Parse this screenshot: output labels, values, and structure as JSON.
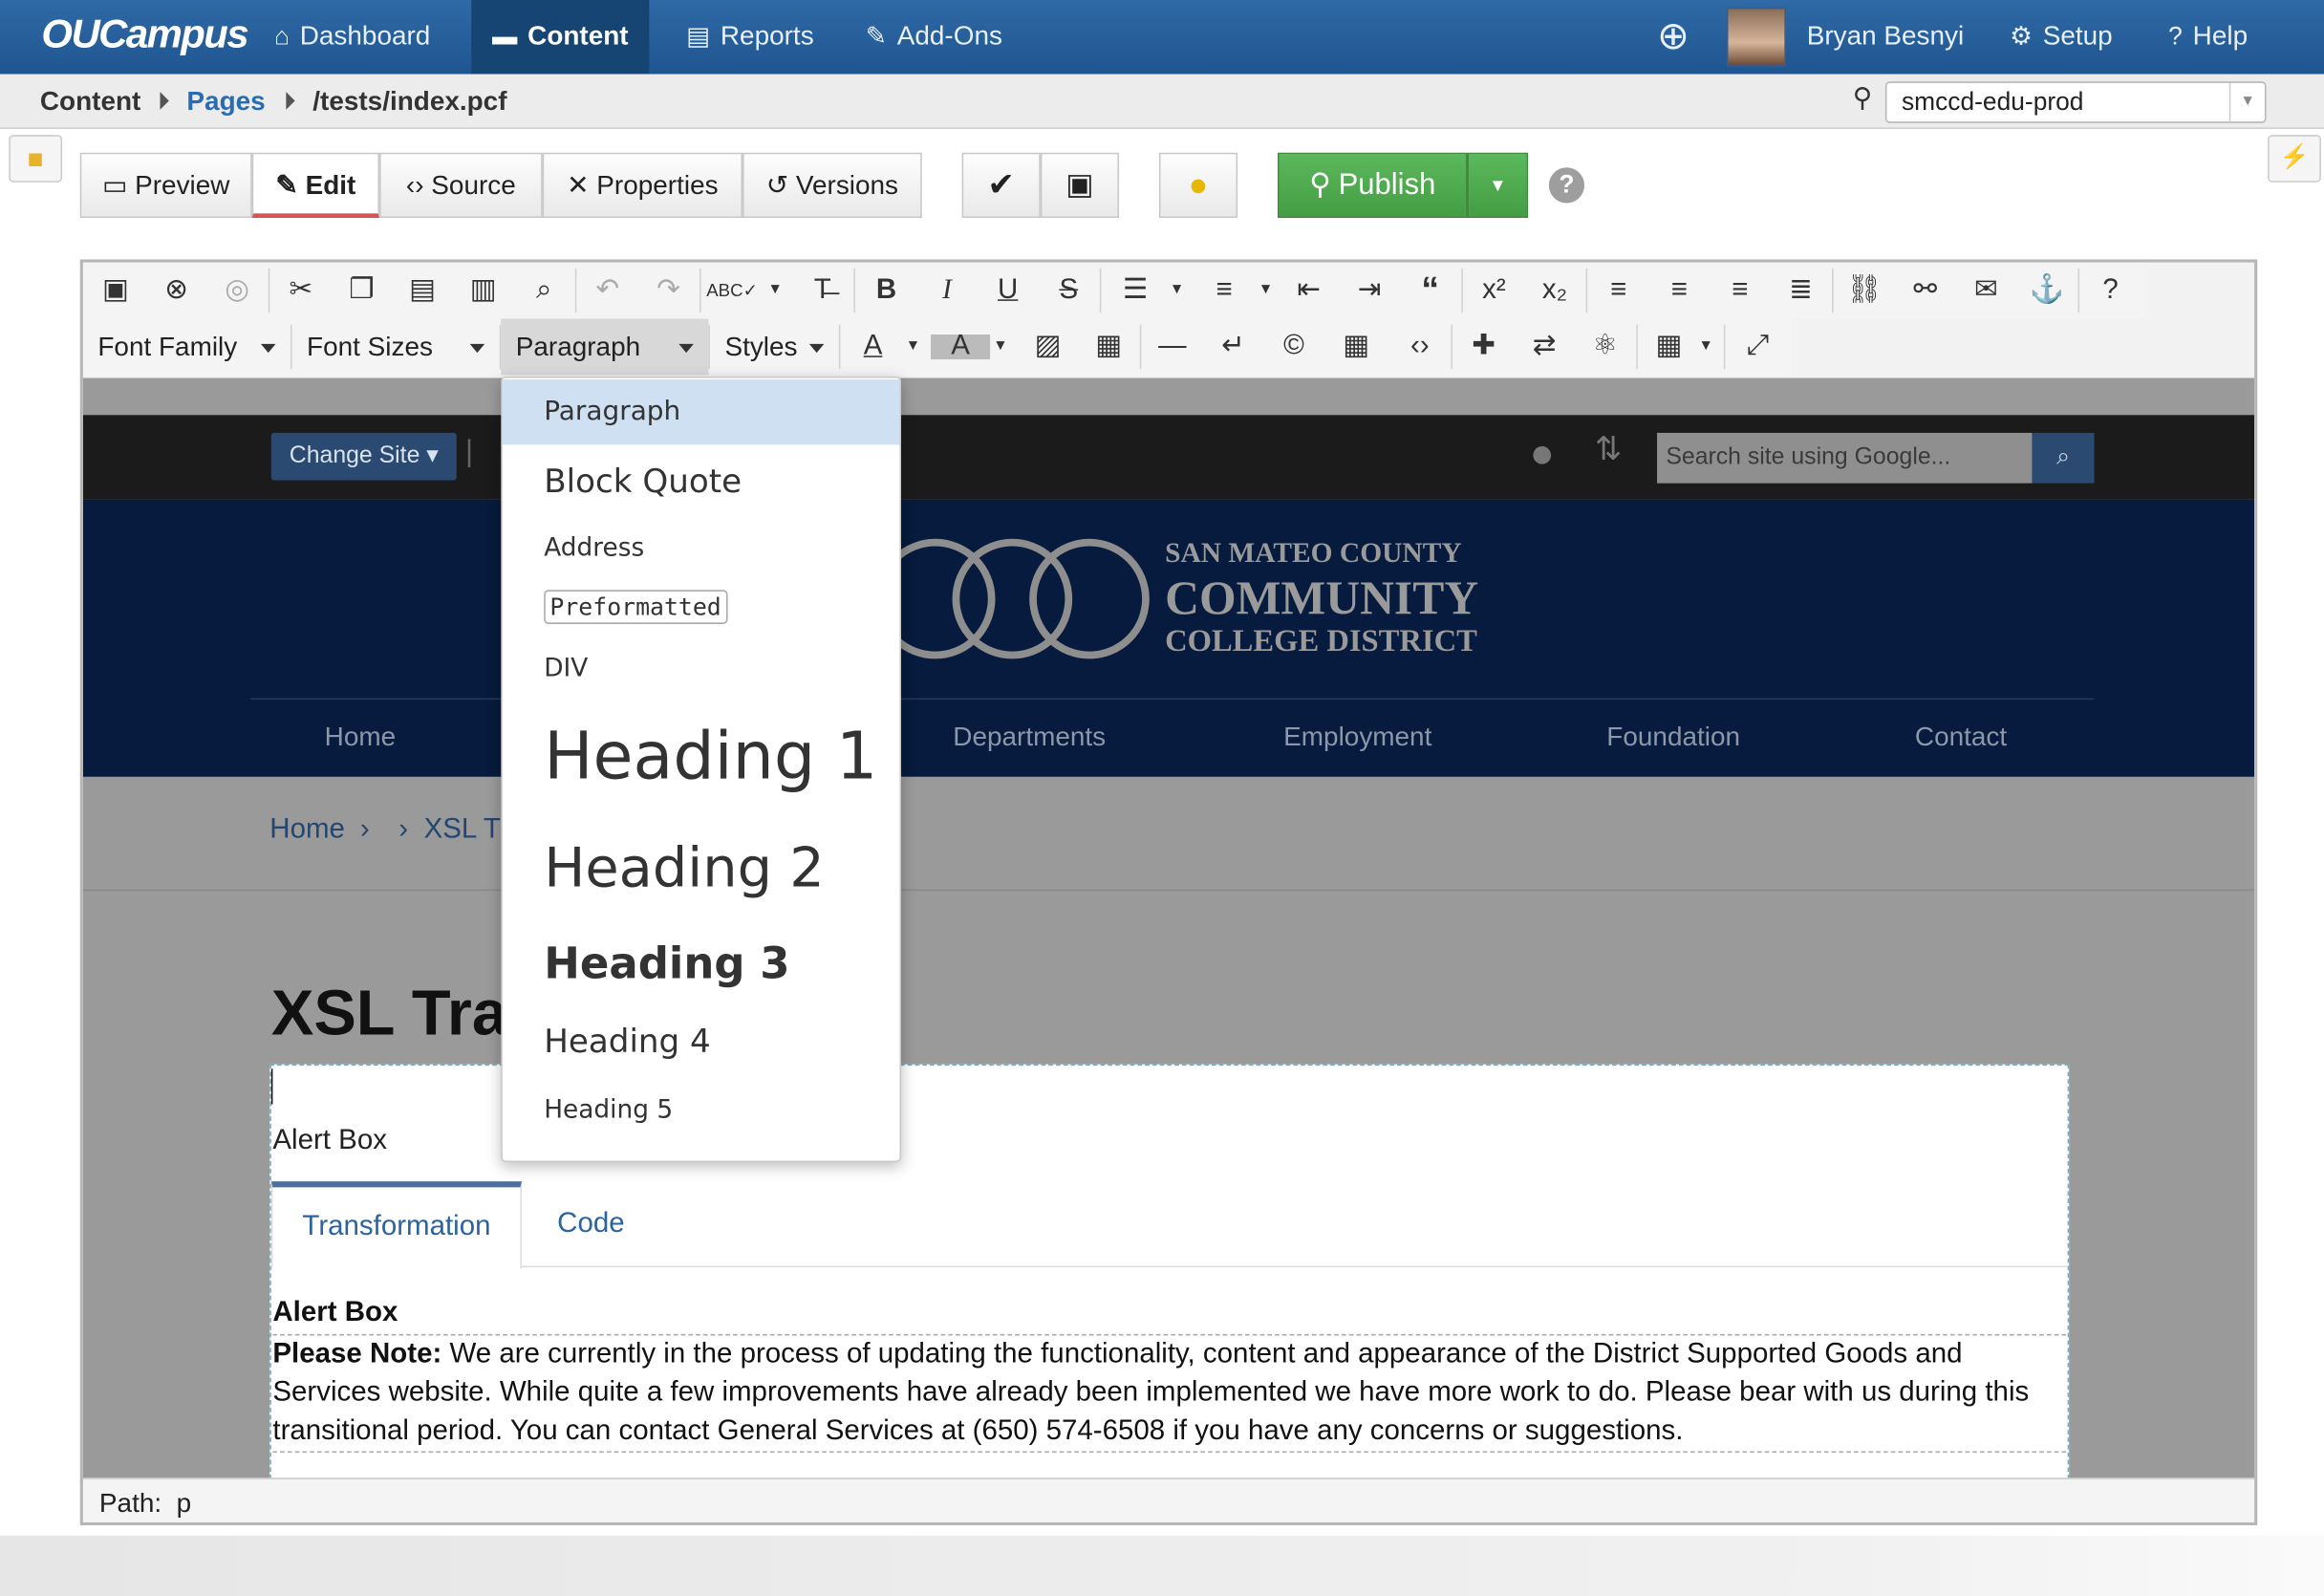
{
  "app": {
    "logo": "OUCampus",
    "nav": [
      "Dashboard",
      "Content",
      "Reports",
      "Add-Ons"
    ],
    "user": "Bryan Besnyi",
    "setup": "Setup",
    "help": "Help"
  },
  "breadcrumb": {
    "root": "Content",
    "pages": "Pages",
    "path": "/tests/index.pcf",
    "site": "smccd-edu-prod"
  },
  "toolbar": {
    "preview": "Preview",
    "edit": "Edit",
    "source": "Source",
    "properties": "Properties",
    "versions": "Versions",
    "publish": "Publish"
  },
  "editor_toolbar": {
    "font_family": "Font Family",
    "font_sizes": "Font Sizes",
    "paragraph": "Paragraph",
    "styles": "Styles"
  },
  "format_menu": {
    "items": [
      "Paragraph",
      "Block Quote",
      "Address",
      "Preformatted",
      "DIV",
      "Heading 1",
      "Heading 2",
      "Heading 3",
      "Heading 4",
      "Heading 5"
    ],
    "selected": "Paragraph"
  },
  "website": {
    "change_site": "Change Site",
    "search_placeholder": "Search site using Google...",
    "seal_line1": "SAN MATEO COUNTY",
    "seal_line2": "COMMUNITY",
    "seal_line3": "COLLEGE DISTRICT",
    "menu": [
      "Home",
      "Departments",
      "Employment",
      "Foundation",
      "Contact"
    ],
    "crumb_home": "Home",
    "crumb_current": "XSL Tr",
    "title": "XSL Tran",
    "asset_label": "Alert Box",
    "tabs": [
      "Transformation",
      "Code"
    ],
    "alert_heading": "Alert Box",
    "alert_note_label": "Please Note:",
    "alert_body": "We are currently in the process of updating the functionality, content and appearance of the District Supported Goods and Services website.  While quite a few improvements have already been implemented we have more work to do.  Please bear with us during this transitional period. You can contact General Services at (650) 574-6508 if you have any concerns or suggestions."
  },
  "statusbar": {
    "path_label": "Path:",
    "path_value": "p"
  }
}
